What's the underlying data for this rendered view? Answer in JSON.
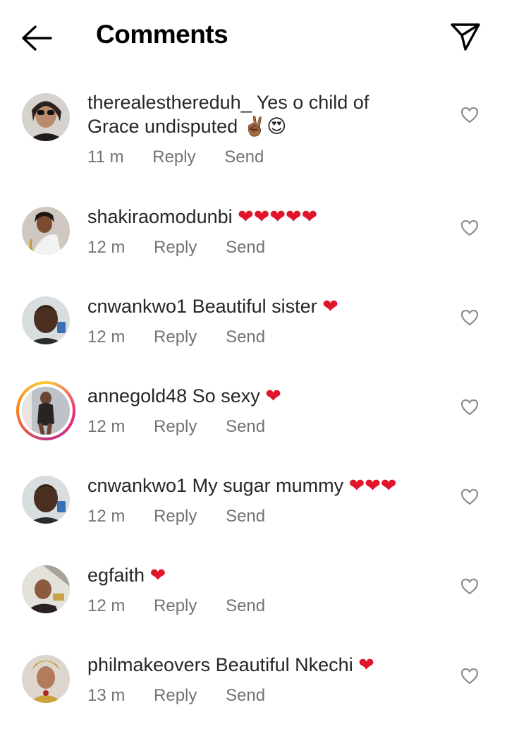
{
  "header": {
    "title": "Comments",
    "back_icon": "arrow-left-icon",
    "send_icon": "paper-plane-icon"
  },
  "comments": [
    {
      "username": "therealesthereduh_",
      "text_line1": "Yes o child of",
      "text_line2": "Grace undisputed",
      "emoji": "✌🏾😍",
      "time": "11 m",
      "reply": "Reply",
      "send": "Send"
    },
    {
      "username": "shakiraomodunbi",
      "text": "",
      "emoji": "❤❤❤❤❤",
      "time": "12 m",
      "reply": "Reply",
      "send": "Send"
    },
    {
      "username": "cnwankwo1",
      "text": "Beautiful sister",
      "emoji": "❤",
      "time": "12 m",
      "reply": "Reply",
      "send": "Send"
    },
    {
      "username": "annegold48",
      "text": "So sexy",
      "emoji": "❤",
      "time": "12 m",
      "reply": "Reply",
      "send": "Send"
    },
    {
      "username": "cnwankwo1",
      "text": "My sugar mummy",
      "emoji": "❤❤❤",
      "time": "12 m",
      "reply": "Reply",
      "send": "Send"
    },
    {
      "username": "egfaith",
      "text": "",
      "emoji": "❤",
      "time": "12 m",
      "reply": "Reply",
      "send": "Send"
    },
    {
      "username": "philmakeovers",
      "text": "Beautiful Nkechi",
      "emoji": "❤",
      "time": "13 m",
      "reply": "Reply",
      "send": "Send"
    }
  ],
  "colors": {
    "text": "#262626",
    "meta": "#737373",
    "heart": "#e0142a",
    "story_ring": "#ee2a7b"
  }
}
